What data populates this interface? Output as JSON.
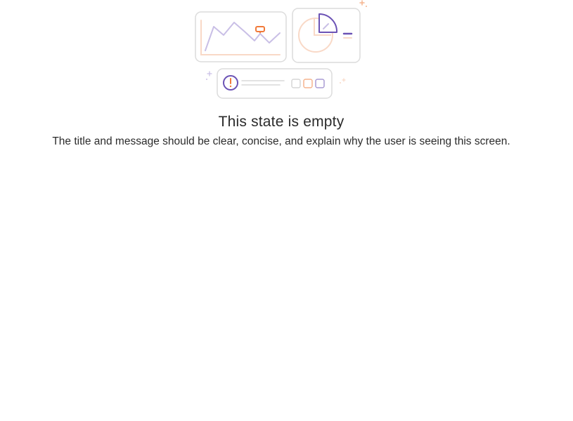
{
  "empty_state": {
    "title": "This state is empty",
    "message": "The title and message should be clear, concise, and explain why the user is seeing this screen."
  },
  "colors": {
    "purple": "#6b52b5",
    "light_purple": "#c9bfe6",
    "orange": "#f07a3a",
    "light_orange": "#f9d9c7",
    "card_border": "#dddddd"
  },
  "icons": [
    "line-chart-card-icon",
    "pie-chart-card-icon",
    "alert-list-card-icon",
    "sparkle-icon"
  ]
}
